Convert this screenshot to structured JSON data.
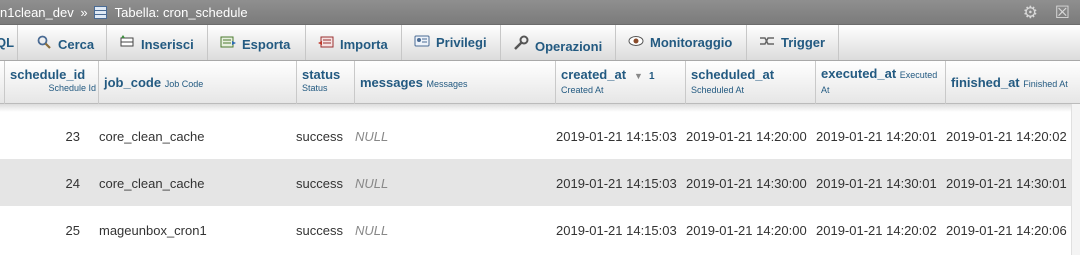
{
  "titlebar": {
    "database": "n1clean_dev",
    "separator": "»",
    "table": "Tabella: cron_schedule",
    "icons": [
      "gear-icon",
      "collapse-icon"
    ]
  },
  "tabs": [
    {
      "label": "QL",
      "icon": ""
    },
    {
      "label": "Cerca",
      "icon": "search-icon"
    },
    {
      "label": "Inserisci",
      "icon": "insert-icon"
    },
    {
      "label": "Esporta",
      "icon": "export-icon"
    },
    {
      "label": "Importa",
      "icon": "import-icon"
    },
    {
      "label": "Privilegi",
      "icon": "privileges-icon"
    },
    {
      "label": "Operazioni",
      "icon": "wrench-icon"
    },
    {
      "label": "Monitoraggio",
      "icon": "eye-icon"
    },
    {
      "label": "Trigger",
      "icon": "trigger-icon"
    }
  ],
  "columns": [
    {
      "name": "schedule_id",
      "comment": "Schedule Id"
    },
    {
      "name": "job_code",
      "comment": "Job Code"
    },
    {
      "name": "status",
      "comment": "Status"
    },
    {
      "name": "messages",
      "comment": "Messages"
    },
    {
      "name": "created_at",
      "comment": "Created At",
      "sort_order": "1"
    },
    {
      "name": "scheduled_at",
      "comment": "Scheduled At"
    },
    {
      "name": "executed_at",
      "comment": "Executed At"
    },
    {
      "name": "finished_at",
      "comment": "Finished At"
    }
  ],
  "rows": [
    {
      "schedule_id": "23",
      "job_code": "core_clean_cache",
      "status": "success",
      "messages": "NULL",
      "created_at": "2019-01-21 14:15:03",
      "scheduled_at": "2019-01-21 14:20:00",
      "executed_at": "2019-01-21 14:20:01",
      "finished_at": "2019-01-21 14:20:02"
    },
    {
      "schedule_id": "24",
      "job_code": "core_clean_cache",
      "status": "success",
      "messages": "NULL",
      "created_at": "2019-01-21 14:15:03",
      "scheduled_at": "2019-01-21 14:30:00",
      "executed_at": "2019-01-21 14:30:01",
      "finished_at": "2019-01-21 14:30:01"
    },
    {
      "schedule_id": "25",
      "job_code": "mageunbox_cron1",
      "status": "success",
      "messages": "NULL",
      "created_at": "2019-01-21 14:15:03",
      "scheduled_at": "2019-01-21 14:20:00",
      "executed_at": "2019-01-21 14:20:02",
      "finished_at": "2019-01-21 14:20:06"
    }
  ],
  "colors": {
    "link": "#235a81",
    "row_alt": "#e5e5e5",
    "titlebar": "#868686"
  }
}
